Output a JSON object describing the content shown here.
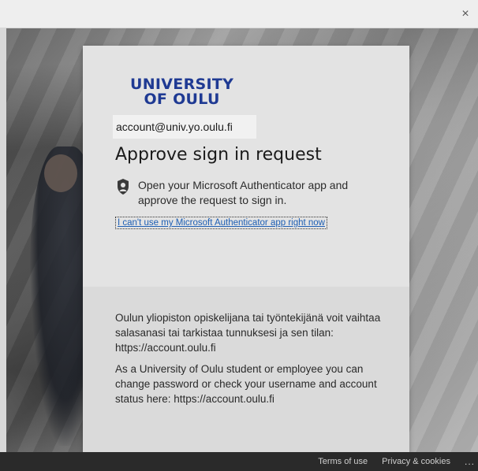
{
  "window": {
    "close_glyph": "×"
  },
  "brand": {
    "line1": "UNIVERSITY",
    "line2": "OF OULU",
    "color": "#1f3a93"
  },
  "signin": {
    "identity": "account@univ.yo.oulu.fi",
    "title": "Approve sign in request",
    "auth_icon": "authenticator-lock-icon",
    "message": "Open your Microsoft Authenticator app and approve the request to sign in.",
    "alt_link": "I can't use my Microsoft Authenticator app right now",
    "link_color": "#1e5fb4"
  },
  "info": {
    "finnish": "Oulun yliopiston opiskelijana tai työntekijänä voit vaihtaa salasanasi tai tarkistaa tunnuksesi ja sen tilan: https://account.oulu.fi",
    "english": "As a University of Oulu student or employee you can change password or check your username and account status here: https://account.oulu.fi"
  },
  "footer": {
    "terms": "Terms of use",
    "privacy": "Privacy & cookies",
    "more": "..."
  }
}
